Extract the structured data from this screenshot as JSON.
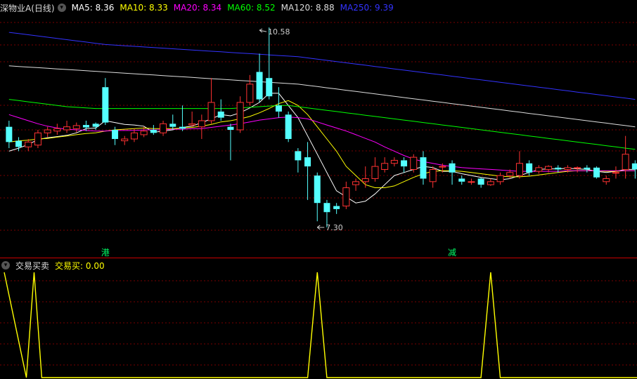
{
  "main_header": {
    "stock_name": "深物业A(日线)",
    "indicators": [
      {
        "label": "MA5: 8.36",
        "color": "#ffffff"
      },
      {
        "label": "MA10: 8.33",
        "color": "#ffff00"
      },
      {
        "label": "MA20: 8.34",
        "color": "#ff00ff"
      },
      {
        "label": "MA60: 8.52",
        "color": "#00ff00"
      },
      {
        "label": "MA120: 8.88",
        "color": "#dddddd"
      },
      {
        "label": "MA250: 9.39",
        "color": "#3333ff"
      }
    ]
  },
  "sub_header": {
    "name": "交易买卖",
    "value_label": "交易买: 0.00",
    "value_color": "#ffff00"
  },
  "colors": {
    "up": "#ff3232",
    "down": "#54ffff",
    "grid": "#7a0000",
    "separator": "#cc0000",
    "signal_line": "#ffff00",
    "marker_text": "#00ff66",
    "annot": "#cccccc"
  },
  "chart_data": [
    {
      "type": "candlestick",
      "title": "深物业A(日线)",
      "y_range": [
        7.0,
        10.8
      ],
      "high_annotation": {
        "label": "10.58",
        "value": 10.58,
        "index": 26
      },
      "low_annotation": {
        "label": "7.30",
        "value": 7.3,
        "index": 32
      },
      "markers": [
        {
          "label": "港",
          "index": 10
        },
        {
          "label": "减",
          "index": 46
        }
      ],
      "candles": [
        [
          8.95,
          8.7,
          9.05,
          8.6
        ],
        [
          8.72,
          8.62,
          8.78,
          8.55
        ],
        [
          8.62,
          8.7,
          8.75,
          8.55
        ],
        [
          8.65,
          8.85,
          8.9,
          8.6
        ],
        [
          8.85,
          8.9,
          8.95,
          8.78
        ],
        [
          8.88,
          8.92,
          9.0,
          8.82
        ],
        [
          8.9,
          8.95,
          9.05,
          8.85
        ],
        [
          8.92,
          8.97,
          9.02,
          8.86
        ],
        [
          8.98,
          8.94,
          9.05,
          8.88
        ],
        [
          9.0,
          8.95,
          9.02,
          8.9
        ],
        [
          9.6,
          9.02,
          9.75,
          8.98
        ],
        [
          8.9,
          8.75,
          8.95,
          8.65
        ],
        [
          8.72,
          8.75,
          8.8,
          8.65
        ],
        [
          8.75,
          8.85,
          8.92,
          8.7
        ],
        [
          8.82,
          8.88,
          8.95,
          8.78
        ],
        [
          8.9,
          8.85,
          8.98,
          8.82
        ],
        [
          8.85,
          9.0,
          9.05,
          8.8
        ],
        [
          9.0,
          8.95,
          9.15,
          8.9
        ],
        [
          8.95,
          8.92,
          9.3,
          8.88
        ],
        [
          8.98,
          9.0,
          9.2,
          8.95
        ],
        [
          8.95,
          9.05,
          9.15,
          8.75
        ],
        [
          9.05,
          9.35,
          9.75,
          9.0
        ],
        [
          9.2,
          9.1,
          9.4,
          9.05
        ],
        [
          8.95,
          8.9,
          9.0,
          8.4
        ],
        [
          8.9,
          9.35,
          9.45,
          8.85
        ],
        [
          9.35,
          9.65,
          9.8,
          9.3
        ],
        [
          9.85,
          9.4,
          10.15,
          9.35
        ],
        [
          9.75,
          9.45,
          10.58,
          9.4
        ],
        [
          9.3,
          9.2,
          9.6,
          9.1
        ],
        [
          9.15,
          8.75,
          9.2,
          8.7
        ],
        [
          8.55,
          8.4,
          8.6,
          8.2
        ],
        [
          8.45,
          8.3,
          8.7,
          7.75
        ],
        [
          8.15,
          7.7,
          8.2,
          7.4
        ],
        [
          7.7,
          7.55,
          7.75,
          7.3
        ],
        [
          7.65,
          7.6,
          7.7,
          7.52
        ],
        [
          7.65,
          7.95,
          8.05,
          7.6
        ],
        [
          8.0,
          8.05,
          8.1,
          7.9
        ],
        [
          8.05,
          8.1,
          8.3,
          7.95
        ],
        [
          8.1,
          8.3,
          8.45,
          8.05
        ],
        [
          8.25,
          8.35,
          8.45,
          8.2
        ],
        [
          8.35,
          8.4,
          8.45,
          8.3
        ],
        [
          8.4,
          8.3,
          8.45,
          8.2
        ],
        [
          8.25,
          8.45,
          8.5,
          8.2
        ],
        [
          8.45,
          8.1,
          8.55,
          8.0
        ],
        [
          8.05,
          8.25,
          8.3,
          7.95
        ],
        [
          8.3,
          8.3,
          8.35,
          8.2
        ],
        [
          8.35,
          8.2,
          8.4,
          8.0
        ],
        [
          8.1,
          8.05,
          8.15,
          8.0
        ],
        [
          8.05,
          8.05,
          8.1,
          8.0
        ],
        [
          8.1,
          8.0,
          8.12,
          7.95
        ],
        [
          8.0,
          8.05,
          8.1,
          7.98
        ],
        [
          8.05,
          8.15,
          8.2,
          8.0
        ],
        [
          8.15,
          8.2,
          8.25,
          8.1
        ],
        [
          8.15,
          8.35,
          8.55,
          8.1
        ],
        [
          8.35,
          8.2,
          8.4,
          8.15
        ],
        [
          8.22,
          8.28,
          8.32,
          8.18
        ],
        [
          8.25,
          8.3,
          8.32,
          8.2
        ],
        [
          8.28,
          8.25,
          8.32,
          8.2
        ],
        [
          8.25,
          8.28,
          8.32,
          8.2
        ],
        [
          8.28,
          8.28,
          8.3,
          8.2
        ],
        [
          8.28,
          8.25,
          8.32,
          8.2
        ],
        [
          8.28,
          8.12,
          8.3,
          8.1
        ],
        [
          8.05,
          8.1,
          8.15,
          8.0
        ],
        [
          8.2,
          8.2,
          8.3,
          8.1
        ],
        [
          8.25,
          8.5,
          8.8,
          8.1
        ],
        [
          8.35,
          8.25,
          8.4,
          8.1
        ]
      ],
      "moving_averages": [
        {
          "name": "MA5",
          "color": "#ffffff",
          "values": [
            8.55,
            8.6,
            8.66,
            8.74,
            8.77,
            8.79,
            8.81,
            8.85,
            8.92,
            8.93,
            9.05,
            9.02,
            8.99,
            8.98,
            8.96,
            8.86,
            8.88,
            8.9,
            8.94,
            8.96,
            9.02,
            9.08,
            9.15,
            9.13,
            9.18,
            9.26,
            9.35,
            9.5,
            9.5,
            9.3,
            9.1,
            8.8,
            8.5,
            8.2,
            7.9,
            7.8,
            7.7,
            7.73,
            7.85,
            8.0,
            8.15,
            8.2,
            8.25,
            8.3,
            8.28,
            8.22,
            8.22,
            8.18,
            8.15,
            8.12,
            8.1,
            8.08,
            8.1,
            8.15,
            8.2,
            8.25,
            8.26,
            8.26,
            8.27,
            8.26,
            8.25,
            8.22,
            8.2,
            8.22,
            8.25,
            8.25
          ]
        },
        {
          "name": "MA10",
          "color": "#ffff00",
          "values": [
            8.7,
            8.72,
            8.73,
            8.75,
            8.76,
            8.78,
            8.8,
            8.82,
            8.84,
            8.85,
            8.88,
            8.9,
            8.91,
            8.92,
            8.93,
            8.92,
            8.92,
            8.92,
            8.93,
            8.94,
            8.96,
            8.99,
            9.03,
            9.05,
            9.08,
            9.12,
            9.18,
            9.25,
            9.33,
            9.38,
            9.3,
            9.15,
            8.95,
            8.75,
            8.55,
            8.3,
            8.15,
            8.0,
            7.95,
            7.95,
            7.98,
            8.05,
            8.12,
            8.18,
            8.22,
            8.23,
            8.23,
            8.22,
            8.2,
            8.18,
            8.16,
            8.14,
            8.13,
            8.13,
            8.14,
            8.16,
            8.18,
            8.2,
            8.22,
            8.23,
            8.23,
            8.23,
            8.22,
            8.22,
            8.23,
            8.23
          ]
        },
        {
          "name": "MA20",
          "color": "#ff00ff",
          "values": [
            9.15,
            9.1,
            9.05,
            9.0,
            8.96,
            8.93,
            8.91,
            8.9,
            8.89,
            8.88,
            8.88,
            8.89,
            8.89,
            8.89,
            8.9,
            8.9,
            8.9,
            8.91,
            8.91,
            8.92,
            8.92,
            8.94,
            8.96,
            8.98,
            9.0,
            9.03,
            9.06,
            9.08,
            9.1,
            9.11,
            9.1,
            9.08,
            9.03,
            8.98,
            8.93,
            8.88,
            8.82,
            8.76,
            8.7,
            8.62,
            8.55,
            8.48,
            8.42,
            8.38,
            8.35,
            8.32,
            8.3,
            8.28,
            8.27,
            8.26,
            8.25,
            8.24,
            8.23,
            8.22,
            8.22,
            8.22,
            8.22,
            8.22,
            8.23,
            8.23,
            8.23,
            8.23,
            8.23,
            8.23,
            8.23,
            8.23
          ]
        },
        {
          "name": "MA60",
          "color": "#00ff00",
          "values": [
            9.4,
            9.38,
            9.36,
            9.34,
            9.32,
            9.3,
            9.28,
            9.27,
            9.26,
            9.25,
            9.25,
            9.25,
            9.25,
            9.25,
            9.25,
            9.25,
            9.25,
            9.25,
            9.25,
            9.25,
            9.25,
            9.25,
            9.25,
            9.25,
            9.26,
            9.27,
            9.28,
            9.29,
            9.3,
            9.3,
            9.28,
            9.26,
            9.24,
            9.22,
            9.2,
            9.18,
            9.16,
            9.14,
            9.12,
            9.1,
            9.08,
            9.06,
            9.04,
            9.02,
            9.0,
            8.98,
            8.96,
            8.94,
            8.92,
            8.9,
            8.88,
            8.86,
            8.84,
            8.82,
            8.8,
            8.78,
            8.76,
            8.74,
            8.72,
            8.7,
            8.68,
            8.66,
            8.64,
            8.62,
            8.6,
            8.58
          ]
        },
        {
          "name": "MA120",
          "color": "#dddddd",
          "values": [
            9.95,
            9.94,
            9.93,
            9.92,
            9.91,
            9.9,
            9.89,
            9.88,
            9.87,
            9.86,
            9.85,
            9.84,
            9.83,
            9.82,
            9.81,
            9.8,
            9.79,
            9.78,
            9.77,
            9.76,
            9.75,
            9.74,
            9.73,
            9.72,
            9.71,
            9.7,
            9.69,
            9.68,
            9.67,
            9.66,
            9.65,
            9.63,
            9.61,
            9.59,
            9.57,
            9.55,
            9.53,
            9.51,
            9.49,
            9.47,
            9.45,
            9.43,
            9.41,
            9.39,
            9.37,
            9.35,
            9.33,
            9.31,
            9.29,
            9.27,
            9.25,
            9.23,
            9.21,
            9.19,
            9.17,
            9.15,
            9.13,
            9.11,
            9.09,
            9.07,
            9.05,
            9.03,
            9.01,
            8.99,
            8.97,
            8.95
          ]
        },
        {
          "name": "MA250",
          "color": "#3333ff",
          "values": [
            10.5,
            10.48,
            10.46,
            10.44,
            10.42,
            10.4,
            10.38,
            10.36,
            10.34,
            10.32,
            10.3,
            10.29,
            10.28,
            10.27,
            10.26,
            10.25,
            10.24,
            10.23,
            10.22,
            10.21,
            10.2,
            10.19,
            10.18,
            10.17,
            10.16,
            10.15,
            10.14,
            10.13,
            10.12,
            10.11,
            10.1,
            10.08,
            10.06,
            10.04,
            10.02,
            10.0,
            9.98,
            9.96,
            9.94,
            9.92,
            9.9,
            9.88,
            9.86,
            9.84,
            9.82,
            9.8,
            9.78,
            9.76,
            9.74,
            9.72,
            9.7,
            9.68,
            9.66,
            9.64,
            9.62,
            9.6,
            9.58,
            9.56,
            9.54,
            9.52,
            9.5,
            9.48,
            9.46,
            9.44,
            9.42,
            9.4
          ]
        }
      ]
    },
    {
      "type": "line",
      "title": "交易买卖",
      "series": [
        {
          "name": "交易买",
          "color": "#ffff00",
          "x": [
            0,
            1.8,
            2.6,
            3.4,
            31,
            32,
            33,
            49,
            50,
            51,
            65
          ],
          "y": [
            1,
            0,
            1,
            0,
            0,
            1,
            0,
            0,
            1,
            0,
            0
          ]
        }
      ],
      "y_range": [
        0,
        1
      ]
    }
  ]
}
